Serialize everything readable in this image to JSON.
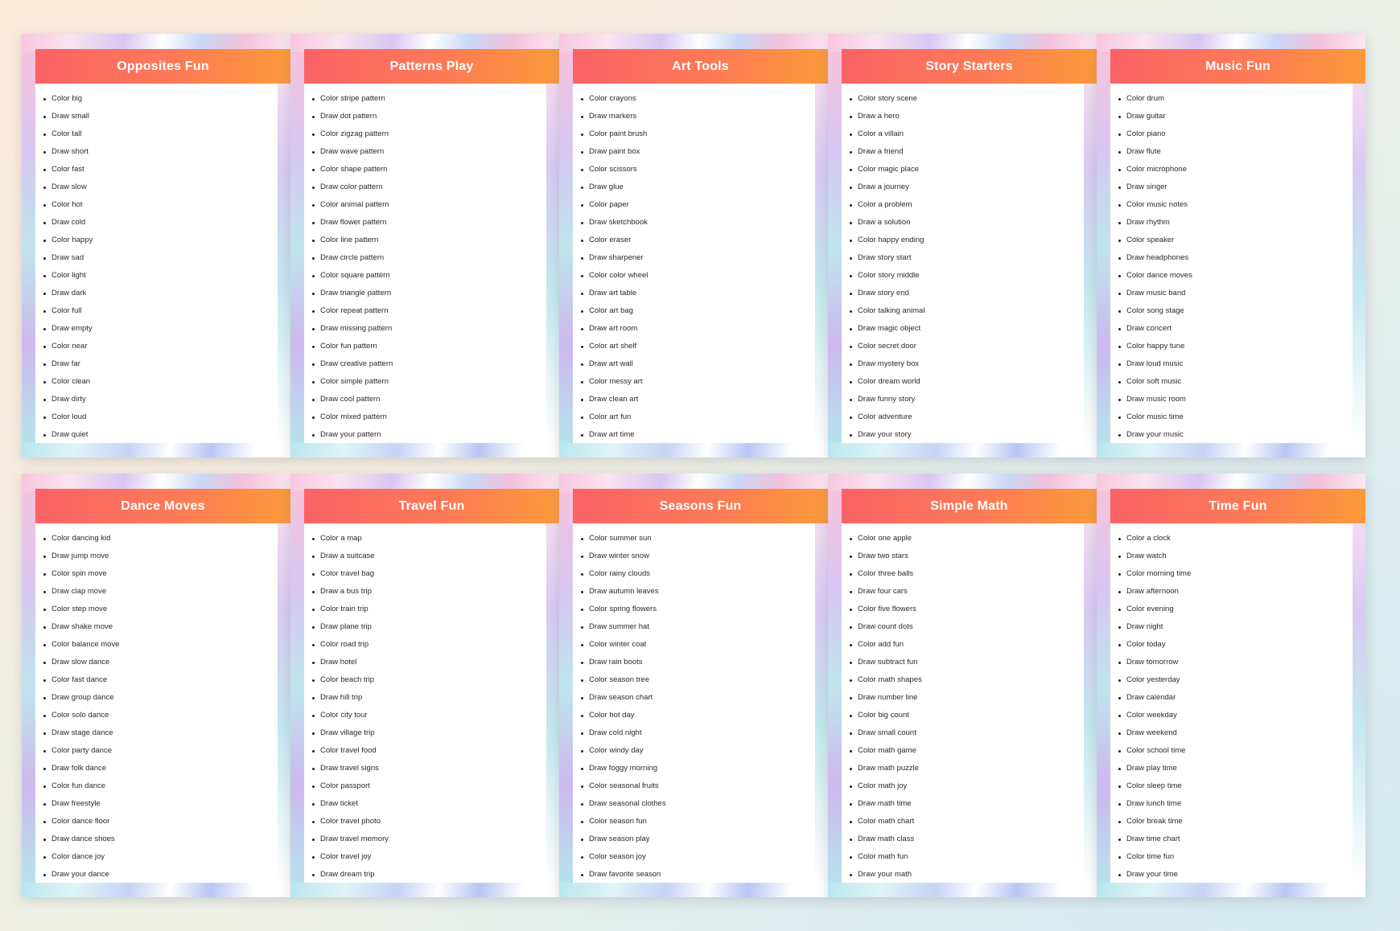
{
  "cards": [
    {
      "title": "Opposites Fun",
      "items": [
        "Color big",
        "Draw small",
        "Color tall",
        "Draw short",
        "Color fast",
        "Draw slow",
        "Color hot",
        "Draw cold",
        "Color happy",
        "Draw sad",
        "Color light",
        "Draw dark",
        "Color full",
        "Draw empty",
        "Color near",
        "Draw far",
        "Color clean",
        "Draw dirty",
        "Color loud",
        "Draw quiet"
      ]
    },
    {
      "title": "Patterns Play",
      "items": [
        "Color stripe pattern",
        "Draw dot pattern",
        "Color zigzag pattern",
        "Draw wave pattern",
        "Color shape pattern",
        "Draw color pattern",
        "Color animal pattern",
        "Draw flower pattern",
        "Color line pattern",
        "Draw circle pattern",
        "Color square pattern",
        "Draw triangle pattern",
        "Color repeat pattern",
        "Draw missing pattern",
        "Color fun pattern",
        "Draw creative pattern",
        "Color simple pattern",
        "Draw cool pattern",
        "Color mixed pattern",
        "Draw your pattern"
      ]
    },
    {
      "title": "Art Tools",
      "items": [
        "Color crayons",
        "Draw markers",
        "Color paint brush",
        "Draw paint box",
        "Color scissors",
        "Draw glue",
        "Color paper",
        "Draw sketchbook",
        "Color eraser",
        "Draw sharpener",
        "Color color wheel",
        "Draw art table",
        "Color art bag",
        "Draw art room",
        "Color art shelf",
        "Draw art wall",
        "Color messy art",
        "Draw clean art",
        "Color art fun",
        "Draw art time"
      ]
    },
    {
      "title": "Story Starters",
      "items": [
        "Color story scene",
        "Draw a hero",
        "Color a villain",
        "Draw a friend",
        "Color magic place",
        "Draw a journey",
        "Color a problem",
        "Draw a solution",
        "Color happy ending",
        "Draw story start",
        "Color story middle",
        "Draw story end",
        "Color talking animal",
        "Draw magic object",
        "Color secret door",
        "Draw mystery box",
        "Color dream world",
        "Draw funny story",
        "Color adventure",
        "Draw your story"
      ]
    },
    {
      "title": "Music Fun",
      "items": [
        "Color drum",
        "Draw guitar",
        "Color piano",
        "Draw flute",
        "Color microphone",
        "Draw singer",
        "Color music notes",
        "Draw rhythm",
        "Color speaker",
        "Draw headphones",
        "Color dance moves",
        "Draw music band",
        "Color song stage",
        "Draw concert",
        "Color happy tune",
        "Draw loud music",
        "Color soft music",
        "Draw music room",
        "Color music time",
        "Draw your music"
      ]
    },
    {
      "title": "Dance Moves",
      "items": [
        "Color dancing kid",
        "Draw jump move",
        "Color spin move",
        "Draw clap move",
        "Color step move",
        "Draw shake move",
        "Color balance move",
        "Draw slow dance",
        "Color fast dance",
        "Draw group dance",
        "Color solo dance",
        "Draw stage dance",
        "Color party dance",
        "Draw folk dance",
        "Color fun dance",
        "Draw freestyle",
        "Color dance floor",
        "Draw dance shoes",
        "Color dance joy",
        "Draw your dance"
      ]
    },
    {
      "title": "Travel Fun",
      "items": [
        "Color a map",
        "Draw a suitcase",
        "Color travel bag",
        "Draw a bus trip",
        "Color train trip",
        "Draw plane trip",
        "Color road trip",
        "Draw hotel",
        "Color beach trip",
        "Draw hill trip",
        "Color city tour",
        "Draw village trip",
        "Color travel food",
        "Draw travel signs",
        "Color passport",
        "Draw ticket",
        "Color travel photo",
        "Draw travel memory",
        "Color travel joy",
        "Draw dream trip"
      ]
    },
    {
      "title": "Seasons Fun",
      "items": [
        "Color summer sun",
        "Draw winter snow",
        "Color rainy clouds",
        "Draw autumn leaves",
        "Color spring flowers",
        "Draw summer hat",
        "Color winter coat",
        "Draw rain boots",
        "Color season tree",
        "Draw season chart",
        "Color hot day",
        "Draw cold night",
        "Color windy day",
        "Draw foggy morning",
        "Color seasonal fruits",
        "Draw seasonal clothes",
        "Color season fun",
        "Draw season play",
        "Color season joy",
        "Draw favorite season"
      ]
    },
    {
      "title": "Simple Math",
      "items": [
        "Color one apple",
        "Draw two stars",
        "Color three balls",
        "Draw four cars",
        "Color five flowers",
        "Draw count dots",
        "Color add fun",
        "Draw subtract fun",
        "Color math shapes",
        "Draw number line",
        "Color big count",
        "Draw small count",
        "Color math game",
        "Draw math puzzle",
        "Color math joy",
        "Draw math time",
        "Color math chart",
        "Draw math class",
        "Color math fun",
        "Draw your math"
      ]
    },
    {
      "title": "Time Fun",
      "items": [
        "Color a clock",
        "Draw watch",
        "Color morning time",
        "Draw afternoon",
        "Color evening",
        "Draw night",
        "Color today",
        "Draw tomorrow",
        "Color yesterday",
        "Draw calendar",
        "Color weekday",
        "Draw weekend",
        "Color school time",
        "Draw play time",
        "Color sleep time",
        "Draw lunch time",
        "Color break time",
        "Draw time chart",
        "Color time fun",
        "Draw your time"
      ]
    }
  ]
}
